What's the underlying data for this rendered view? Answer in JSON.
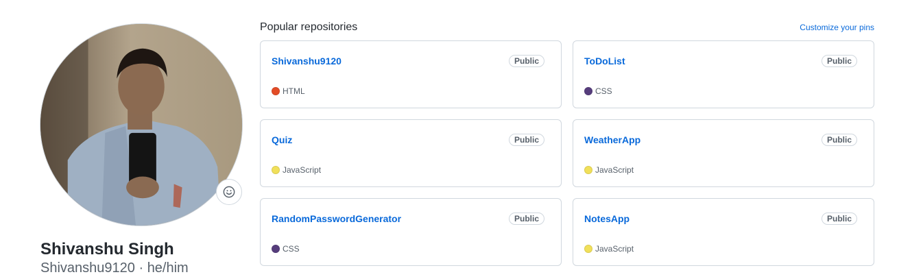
{
  "profile": {
    "name": "Shivanshu Singh",
    "login": "Shivanshu9120",
    "separator": "·",
    "pronouns": "he/him"
  },
  "popular": {
    "title": "Popular repositories",
    "customize_label": "Customize your pins"
  },
  "repos": [
    {
      "name": "Shivanshu9120",
      "visibility": "Public",
      "language": "HTML",
      "lang_color": "#e34c26"
    },
    {
      "name": "ToDoList",
      "visibility": "Public",
      "language": "CSS",
      "lang_color": "#563d7c"
    },
    {
      "name": "Quiz",
      "visibility": "Public",
      "language": "JavaScript",
      "lang_color": "#f1e05a"
    },
    {
      "name": "WeatherApp",
      "visibility": "Public",
      "language": "JavaScript",
      "lang_color": "#f1e05a"
    },
    {
      "name": "RandomPasswordGenerator",
      "visibility": "Public",
      "language": "CSS",
      "lang_color": "#563d7c"
    },
    {
      "name": "NotesApp",
      "visibility": "Public",
      "language": "JavaScript",
      "lang_color": "#f1e05a"
    }
  ],
  "icons": {
    "status": "smiley-icon"
  }
}
